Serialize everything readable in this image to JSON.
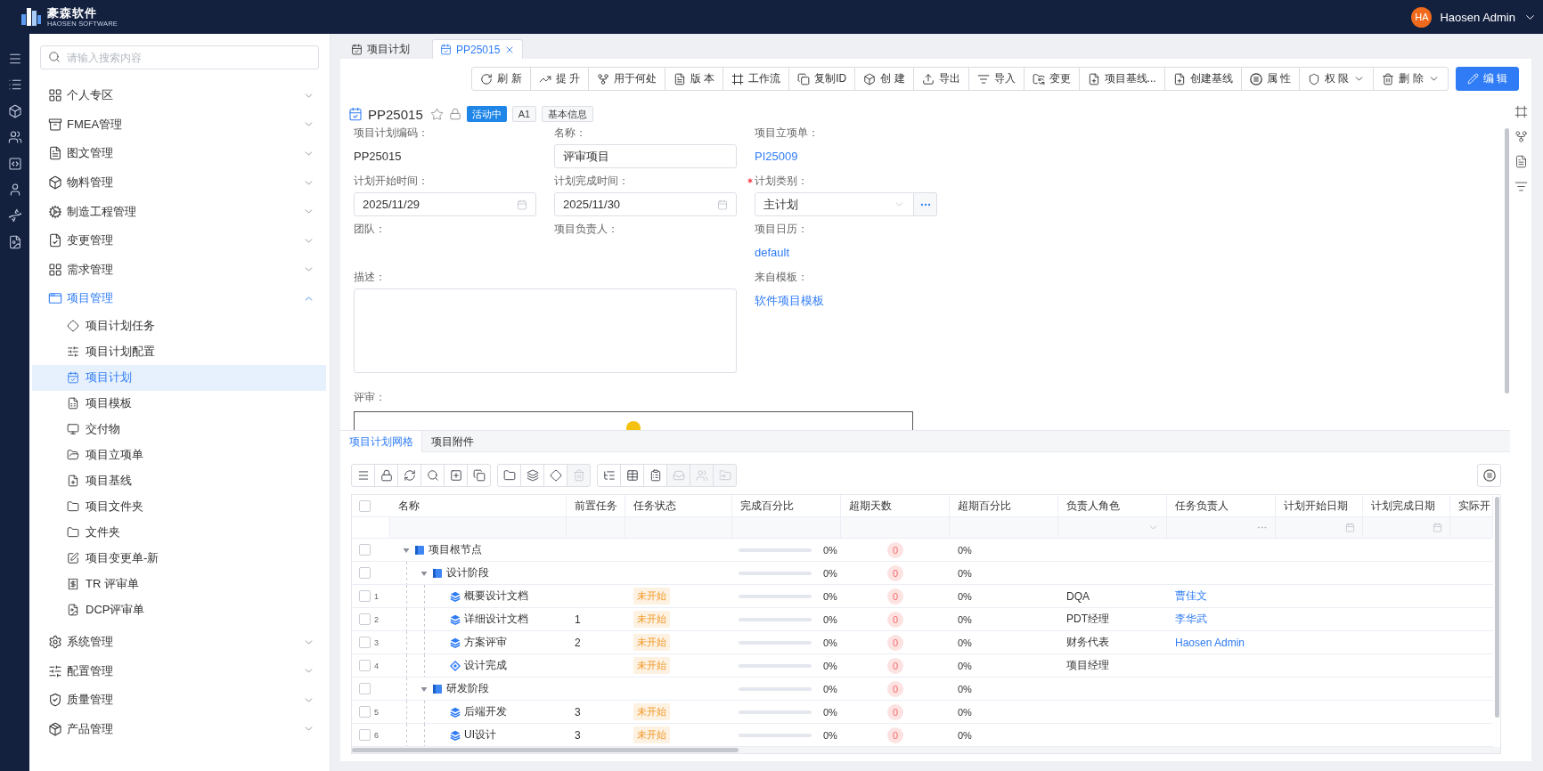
{
  "header": {
    "logo": {
      "name": "豪森软件",
      "tagline": "HAOSEN SOFTWARE"
    },
    "user": {
      "initials": "HA",
      "name": "Haosen Admin"
    }
  },
  "sidebar": {
    "search": {
      "placeholder": "请输入搜索内容"
    },
    "items": [
      {
        "label": "个人专区",
        "expanded": false
      },
      {
        "label": "FMEA管理",
        "expanded": false
      },
      {
        "label": "图文管理",
        "expanded": false
      },
      {
        "label": "物料管理",
        "expanded": false
      },
      {
        "label": "制造工程管理",
        "expanded": false
      },
      {
        "label": "变更管理",
        "expanded": false
      },
      {
        "label": "需求管理",
        "expanded": false
      },
      {
        "label": "项目管理",
        "expanded": true,
        "children": [
          {
            "label": "项目计划任务",
            "selected": false
          },
          {
            "label": "项目计划配置",
            "selected": false
          },
          {
            "label": "项目计划",
            "selected": true
          },
          {
            "label": "项目模板",
            "selected": false
          },
          {
            "label": "交付物",
            "selected": false
          },
          {
            "label": "项目立项单",
            "selected": false
          },
          {
            "label": "项目基线",
            "selected": false
          },
          {
            "label": "项目文件夹",
            "selected": false
          },
          {
            "label": "文件夹",
            "selected": false
          },
          {
            "label": "项目变更单-新",
            "selected": false
          },
          {
            "label": "TR 评审单",
            "selected": false
          },
          {
            "label": "DCP评审单",
            "selected": false
          }
        ]
      },
      {
        "label": "系统管理",
        "expanded": false
      },
      {
        "label": "配置管理",
        "expanded": false
      },
      {
        "label": "质量管理",
        "expanded": false
      },
      {
        "label": "产品管理",
        "expanded": false
      }
    ]
  },
  "tabs": [
    {
      "label": "项目计划",
      "selected": false,
      "closable": false
    },
    {
      "label": "PP25015",
      "selected": true,
      "closable": true
    }
  ],
  "toolbar": {
    "buttons": [
      {
        "label": "刷 新",
        "kind": "plain"
      },
      {
        "label": "提 升",
        "kind": "plain"
      },
      {
        "label": "用于何处",
        "kind": "plain"
      },
      {
        "label": "版 本",
        "kind": "plain"
      },
      {
        "label": "工作流",
        "kind": "plain"
      },
      {
        "label": "复制ID",
        "kind": "plain"
      },
      {
        "label": "创 建",
        "kind": "plain"
      },
      {
        "label": "导出",
        "kind": "plain"
      },
      {
        "label": "导入",
        "kind": "plain"
      },
      {
        "label": "变更",
        "kind": "plain"
      },
      {
        "label": "项目基线...",
        "kind": "plain"
      },
      {
        "label": "创建基线",
        "kind": "plain"
      },
      {
        "label": "属 性",
        "kind": "plain"
      },
      {
        "label": "权 限",
        "kind": "dropdown"
      },
      {
        "label": "删 除",
        "kind": "dropdown"
      },
      {
        "label": "编 辑",
        "kind": "primary"
      }
    ]
  },
  "record": {
    "title": "PP25015",
    "starred": false,
    "badges": [
      {
        "label": "活动中",
        "kind": "status"
      },
      {
        "label": "A1",
        "kind": "tag"
      },
      {
        "label": "基本信息",
        "kind": "tag"
      }
    ]
  },
  "form": {
    "fields": [
      {
        "label": "项目计划编码：",
        "kind": "text",
        "value": "PP25015",
        "required": false
      },
      {
        "label": "名称：",
        "kind": "input",
        "value": "评审项目",
        "required": false
      },
      {
        "label": "项目立项单：",
        "kind": "link",
        "value": "PI25009",
        "required": false
      },
      {
        "label": "计划开始时间：",
        "kind": "date",
        "value": "2025/11/29",
        "required": false
      },
      {
        "label": "计划完成时间：",
        "kind": "date",
        "value": "2025/11/30",
        "required": false
      },
      {
        "label": "计划类别：",
        "kind": "select",
        "value": "主计划",
        "required": true
      },
      {
        "label": "团队：",
        "kind": "empty",
        "required": false
      },
      {
        "label": "项目负责人：",
        "kind": "empty",
        "required": false
      },
      {
        "label": "项目日历：",
        "kind": "link",
        "value": "default",
        "required": false
      },
      {
        "label": "描述：",
        "kind": "textarea",
        "required": false
      },
      {
        "label": "来自模板：",
        "kind": "link",
        "value": "软件项目模板",
        "required": false
      },
      {
        "label": "评审：",
        "kind": "review",
        "required": false
      }
    ]
  },
  "grid": {
    "tabs": [
      {
        "label": "项目计划网格",
        "selected": true
      },
      {
        "label": "项目附件",
        "selected": false
      }
    ],
    "tools": [
      [
        {
          "disabled": false
        },
        {
          "disabled": false
        },
        {
          "disabled": false
        },
        {
          "disabled": false
        },
        {
          "disabled": false
        },
        {
          "disabled": false
        }
      ],
      [
        {
          "disabled": false
        },
        {
          "disabled": false
        },
        {
          "disabled": false
        },
        {
          "disabled": true
        }
      ],
      [
        {
          "disabled": false
        },
        {
          "disabled": false
        },
        {
          "disabled": false
        },
        {
          "disabled": true
        },
        {
          "disabled": true
        },
        {
          "disabled": true
        }
      ]
    ],
    "select_all": {
      "checked": false
    },
    "columns": [
      {
        "label": "名称",
        "kind": "text"
      },
      {
        "label": "前置任务",
        "kind": "text"
      },
      {
        "label": "任务状态",
        "kind": "text"
      },
      {
        "label": "完成百分比",
        "kind": "text"
      },
      {
        "label": "超期天数",
        "kind": "text"
      },
      {
        "label": "超期百分比",
        "kind": "text"
      },
      {
        "label": "负责人角色",
        "kind": "select"
      },
      {
        "label": "任务负责人",
        "kind": "picker"
      },
      {
        "label": "计划开始日期",
        "kind": "date"
      },
      {
        "label": "计划完成日期",
        "kind": "date"
      },
      {
        "label": "实际开",
        "kind": "text"
      }
    ],
    "rows": [
      {
        "name": "项目根节点",
        "kind": "root",
        "checked": false,
        "expanded": true,
        "progress": {
          "level": 0,
          "percent": "0%"
        },
        "overdue_days": "0",
        "overdue_percent": "0%",
        "children": [
          {
            "name": "设计阶段",
            "kind": "phase",
            "checked": false,
            "expanded": true,
            "progress": {
              "level": 0,
              "percent": "0%"
            },
            "overdue_days": "0",
            "overdue_percent": "0%",
            "children": [
              {
                "number": "1",
                "name": "概要设计文档",
                "kind": "task",
                "checked": false,
                "status": "未开始",
                "progress": {
                  "level": 0,
                  "percent": "0%"
                },
                "overdue_days": "0",
                "overdue_percent": "0%",
                "role": "DQA",
                "owner": "曹佳文"
              },
              {
                "number": "2",
                "name": "详细设计文档",
                "kind": "task",
                "checked": false,
                "predecessor": "1",
                "status": "未开始",
                "progress": {
                  "level": 0,
                  "percent": "0%"
                },
                "overdue_days": "0",
                "overdue_percent": "0%",
                "role": "PDT经理",
                "owner": "李华武"
              },
              {
                "number": "3",
                "name": "方案评审",
                "kind": "task",
                "checked": false,
                "predecessor": "2",
                "status": "未开始",
                "progress": {
                  "level": 0,
                  "percent": "0%"
                },
                "overdue_days": "0",
                "overdue_percent": "0%",
                "role": "财务代表",
                "owner": "Haosen Admin"
              },
              {
                "number": "4",
                "name": "设计完成",
                "kind": "milestone",
                "checked": false,
                "status": "未开始",
                "progress": {
                  "level": 0,
                  "percent": "0%"
                },
                "overdue_days": "0",
                "overdue_percent": "0%",
                "role": "项目经理"
              }
            ]
          },
          {
            "name": "研发阶段",
            "kind": "phase",
            "checked": false,
            "expanded": true,
            "progress": {
              "level": 0,
              "percent": "0%"
            },
            "overdue_days": "0",
            "overdue_percent": "0%",
            "children": [
              {
                "number": "5",
                "name": "后端开发",
                "kind": "task",
                "checked": false,
                "predecessor": "3",
                "status": "未开始",
                "progress": {
                  "level": 0,
                  "percent": "0%"
                },
                "overdue_days": "0",
                "overdue_percent": "0%"
              },
              {
                "number": "6",
                "name": "UI设计",
                "kind": "task",
                "checked": false,
                "predecessor": "3",
                "status": "未开始",
                "progress": {
                  "level": 0,
                  "percent": "0%"
                },
                "overdue_days": "0",
                "overdue_percent": "0%"
              }
            ]
          }
        ]
      }
    ]
  }
}
